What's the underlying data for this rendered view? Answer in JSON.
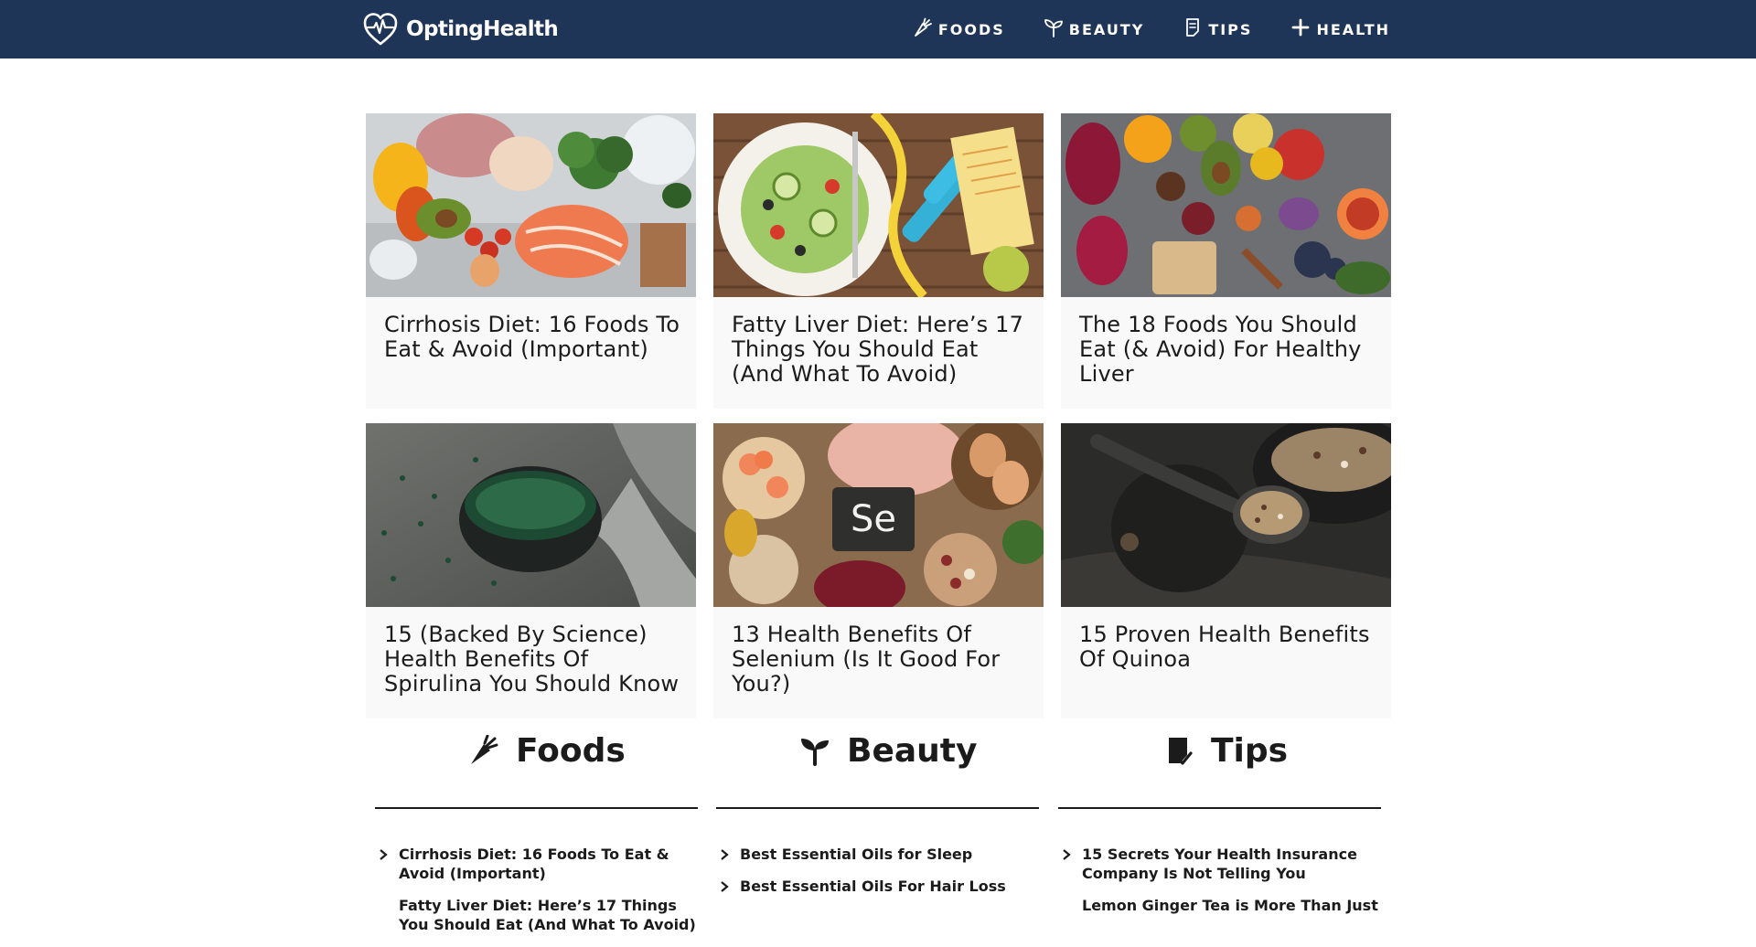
{
  "header": {
    "brand": "OptingHealth",
    "nav": [
      {
        "label": "FOODS",
        "icon": "carrot-icon"
      },
      {
        "label": "BEAUTY",
        "icon": "sprout-icon"
      },
      {
        "label": "TIPS",
        "icon": "notepad-icon"
      },
      {
        "label": "HEALTH",
        "icon": "plus-icon"
      }
    ]
  },
  "cards": [
    {
      "title": "Cirrhosis Diet: 16 Foods To Eat & Avoid (Important)",
      "image": "food-spread-photo"
    },
    {
      "title": "Fatty Liver Diet: Here’s 17 Things You Should Eat (And What To Avoid)",
      "image": "salad-dumbbell-photo"
    },
    {
      "title": "The 18 Foods You Should Eat (& Avoid) For Healthy Liver",
      "image": "healthy-liver-foods-photo"
    },
    {
      "title": "15 (Backed By Science) Health Benefits Of Spirulina You Should Know",
      "image": "spirulina-bowl-photo"
    },
    {
      "title": "13 Health Benefits Of Selenium (Is It Good For You?)",
      "image": "selenium-foods-photo"
    },
    {
      "title": "15 Proven Health Benefits Of Quinoa",
      "image": "quinoa-spoon-photo"
    }
  ],
  "categories": {
    "foods": {
      "label": "Foods",
      "icon": "carrot-icon",
      "items": [
        "Cirrhosis Diet: 16 Foods To Eat & Avoid (Important)",
        "Fatty Liver Diet: Here’s 17 Things You Should Eat (And What To Avoid)"
      ]
    },
    "beauty": {
      "label": "Beauty",
      "icon": "sprout-icon",
      "items": [
        "Best Essential Oils for Sleep",
        "Best Essential Oils For Hair Loss"
      ]
    },
    "tips": {
      "label": "Tips",
      "icon": "notepad-icon",
      "items": [
        "15 Secrets Your Health Insurance Company Is Not Telling You",
        "Lemon Ginger Tea is More Than Just"
      ]
    }
  },
  "colors": {
    "header_bg": "#1f3557",
    "card_bg": "#f9f9f9",
    "text": "#1b1b1b"
  }
}
